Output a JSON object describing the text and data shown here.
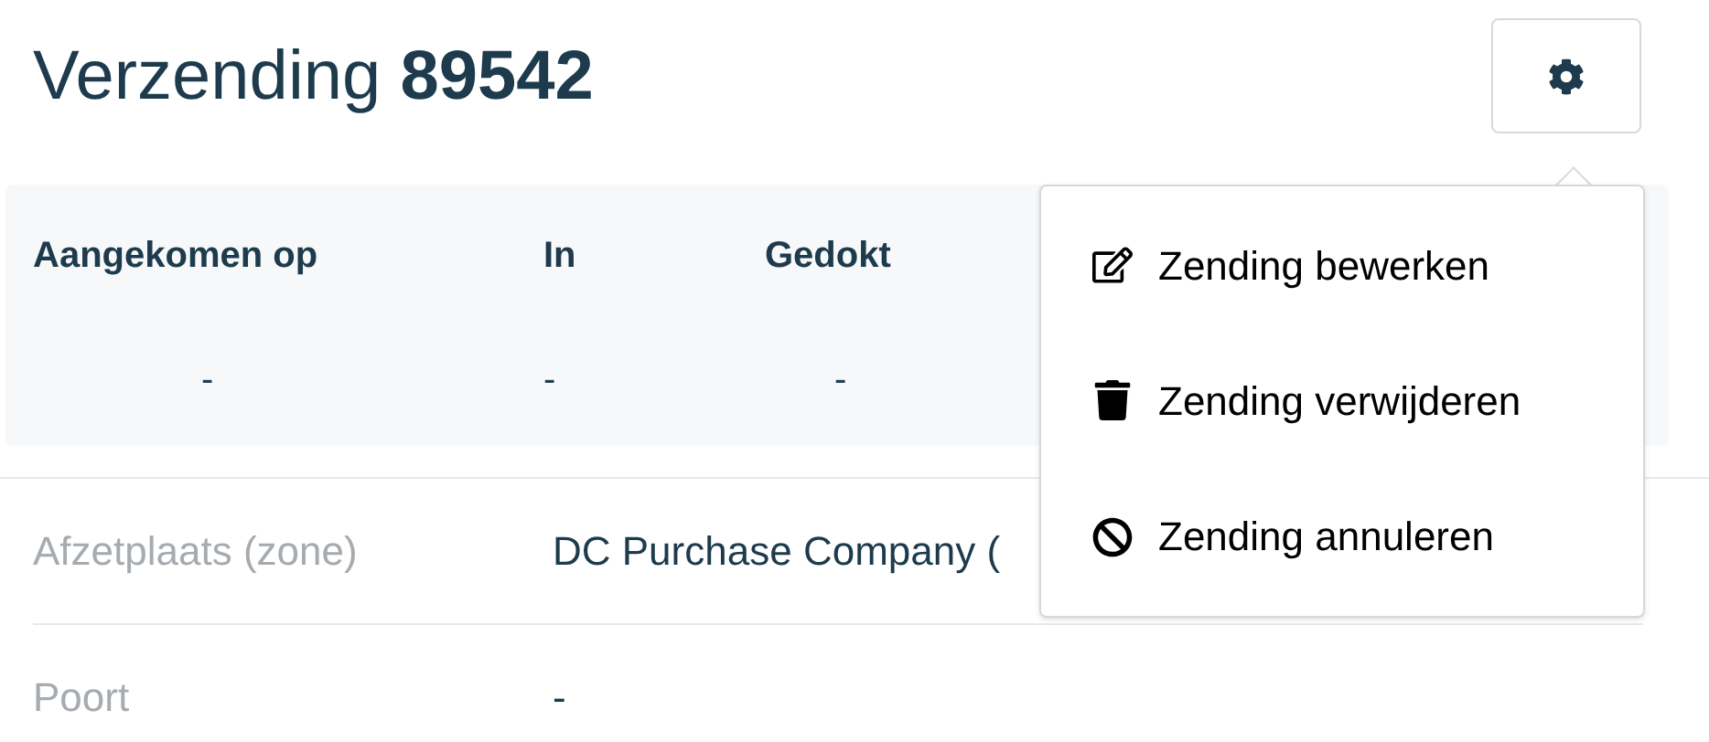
{
  "title": {
    "prefix": "Verzending",
    "number": "89542"
  },
  "stats": [
    {
      "label": "Aangekomen op",
      "value": "-"
    },
    {
      "label": "In",
      "value": "-"
    },
    {
      "label": "Gedokt",
      "value": "-"
    }
  ],
  "details": [
    {
      "label": "Afzetplaats (zone)",
      "value": "DC Purchase Company ("
    },
    {
      "label": "Poort",
      "value": "-"
    }
  ],
  "settings_menu": {
    "items": [
      {
        "kind": "edit",
        "label": "Zending bewerken"
      },
      {
        "kind": "delete",
        "label": "Zending verwijderen"
      },
      {
        "kind": "cancel",
        "label": "Zending annuleren"
      }
    ]
  }
}
